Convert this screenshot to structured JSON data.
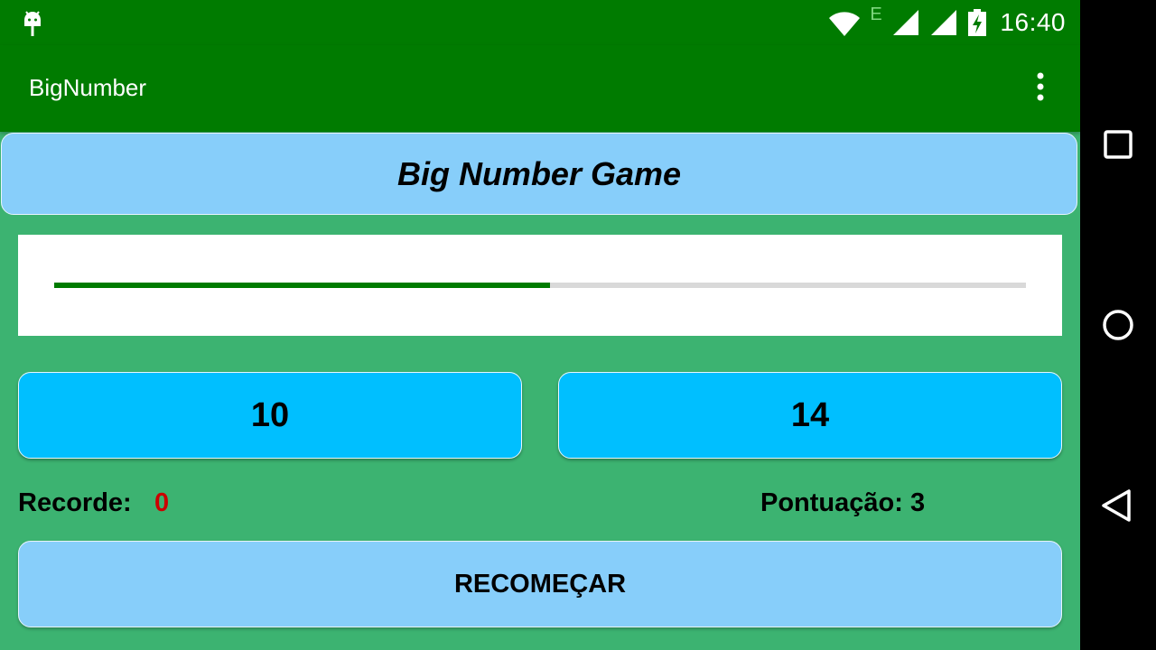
{
  "status_bar": {
    "time": "16:40",
    "network_type": "E",
    "icons": [
      "android-debug-icon",
      "wifi-icon",
      "signal-icon",
      "signal-icon",
      "battery-charging-icon"
    ]
  },
  "app_bar": {
    "title": "BigNumber",
    "menu_icon": "more-vert-icon"
  },
  "game": {
    "header": "Big Number Game",
    "progress_fraction": 0.51,
    "left_number": "10",
    "right_number": "14",
    "record_label": "Recorde:",
    "record_value": "0",
    "score_text": "Pontuação: 3",
    "restart_label": "RECOMEÇAR"
  },
  "nav_bar": {
    "icons": [
      "recents-square-icon",
      "home-circle-icon",
      "back-triangle-icon"
    ]
  },
  "colors": {
    "app_bar": "#007b00",
    "background": "#3cb371",
    "header_card": "#87cefa",
    "number_button": "#00bfff",
    "progress_fill": "#007b00",
    "progress_track": "#d9d9d9",
    "record_value": "#cc0000"
  }
}
